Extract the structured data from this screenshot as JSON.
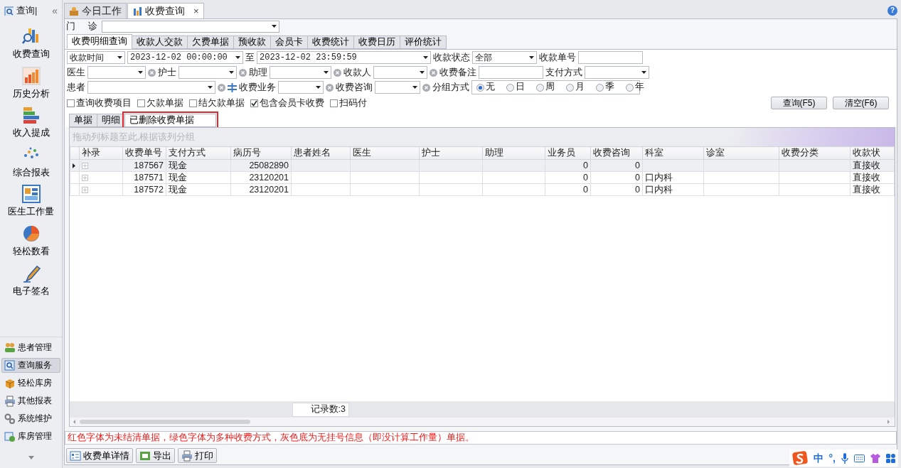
{
  "sidebar": {
    "title": "查询|",
    "collapse": "«",
    "items": [
      {
        "label": "收费查询"
      },
      {
        "label": "历史分析"
      },
      {
        "label": "收入提成"
      },
      {
        "label": "综合报表"
      },
      {
        "label": "医生工作量"
      },
      {
        "label": "轻松数看"
      },
      {
        "label": "电子签名"
      }
    ],
    "groups": [
      {
        "label": "患者管理",
        "selected": false
      },
      {
        "label": "查询服务",
        "selected": true
      },
      {
        "label": "轻松库房",
        "selected": false
      },
      {
        "label": "其他报表",
        "selected": false
      },
      {
        "label": "系统维护",
        "selected": false
      },
      {
        "label": "库房管理",
        "selected": false
      }
    ]
  },
  "tabs": [
    {
      "label": "今日工作",
      "selected": false
    },
    {
      "label": "收费查询",
      "selected": true,
      "close": "×"
    }
  ],
  "help": "?",
  "clinic": {
    "labels": [
      "门",
      "诊"
    ]
  },
  "query_tabs": [
    {
      "label": "收费明细查询",
      "selected": true
    },
    {
      "label": "收款人交款",
      "selected": false
    },
    {
      "label": "欠费单据",
      "selected": false
    },
    {
      "label": "预收款",
      "selected": false
    },
    {
      "label": "会员卡",
      "selected": false
    },
    {
      "label": "收费统计",
      "selected": false
    },
    {
      "label": "收费日历",
      "selected": false
    },
    {
      "label": "评价统计",
      "selected": false
    }
  ],
  "filter_rows": [
    [
      {
        "kind": "select",
        "value": "收款时间"
      },
      {
        "kind": "select",
        "value": "2023-12-02 00:00:00"
      },
      {
        "kind": "label",
        "text": "至"
      },
      {
        "kind": "select",
        "value": "2023-12-02 23:59:59"
      },
      {
        "kind": "label",
        "text": "收款状态"
      },
      {
        "kind": "select",
        "value": "全部"
      },
      {
        "kind": "label",
        "text": "收款单号"
      },
      {
        "kind": "text"
      }
    ],
    [
      {
        "kind": "label",
        "text": "医生"
      },
      {
        "kind": "combo"
      },
      {
        "kind": "label",
        "text": "护士"
      },
      {
        "kind": "combo"
      },
      {
        "kind": "label",
        "text": "助理"
      },
      {
        "kind": "combo"
      },
      {
        "kind": "label",
        "text": "收款人"
      },
      {
        "kind": "combo"
      },
      {
        "kind": "label",
        "text": "收费备注"
      },
      {
        "kind": "text"
      },
      {
        "kind": "label",
        "text": "支付方式"
      },
      {
        "kind": "select"
      }
    ],
    [
      {
        "kind": "label",
        "text": "患者"
      },
      {
        "kind": "combo",
        "add": true
      },
      {
        "kind": "label",
        "text": "收费业务"
      },
      {
        "kind": "combo"
      },
      {
        "kind": "label",
        "text": "收费咨询"
      },
      {
        "kind": "combo"
      },
      {
        "kind": "label",
        "text": "分组方式"
      },
      {
        "kind": "radio",
        "options": [
          {
            "label": "无",
            "selected": true
          },
          {
            "label": "日",
            "selected": false
          },
          {
            "label": "周",
            "selected": false
          },
          {
            "label": "月",
            "selected": false
          },
          {
            "label": "季",
            "selected": false
          },
          {
            "label": "年",
            "selected": false
          }
        ]
      }
    ]
  ],
  "checkboxes": [
    {
      "label": "查询收费项目",
      "checked": false
    },
    {
      "label": "欠款单据",
      "checked": false
    },
    {
      "label": "结欠款单据",
      "checked": false
    },
    {
      "label": "包含会员卡收费",
      "checked": true
    },
    {
      "label": "扫码付",
      "checked": false
    }
  ],
  "buttons": [
    "查询(F5)",
    "清空(F6)"
  ],
  "sub_tabs": [
    {
      "label": "单据",
      "selected": false,
      "highlighted": false
    },
    {
      "label": "明细",
      "selected": false,
      "highlighted": false
    },
    {
      "label": "已删除收费单据",
      "selected": true,
      "highlighted": true
    }
  ],
  "grid": {
    "group_hint": "拖动列标题至此,根据该列分组",
    "columns": [
      "补录",
      "收费单号",
      "支付方式",
      "病历号",
      "患者姓名",
      "医生",
      "护士",
      "助理",
      "业务员",
      "收费咨询",
      "科室",
      "诊室",
      "收费分类",
      "收款状"
    ],
    "rows": [
      {
        "selected": true,
        "cells": [
          null,
          "187567",
          "现金",
          "25082890",
          null,
          null,
          null,
          null,
          "0",
          "0",
          null,
          null,
          null,
          "直接收"
        ]
      },
      {
        "selected": false,
        "cells": [
          null,
          "187571",
          "现金",
          "23120201",
          null,
          null,
          null,
          null,
          "0",
          "0",
          "口内科",
          null,
          null,
          "直接收"
        ]
      },
      {
        "selected": false,
        "cells": [
          null,
          "187572",
          "现金",
          "23120201",
          null,
          null,
          null,
          null,
          "0",
          "0",
          "口内科",
          null,
          null,
          "直接收"
        ]
      }
    ],
    "record_count": "记录数:3"
  },
  "message": "红色字体为未结清单据，绿色字体为多种收费方式，灰色底为无挂号信息（即没计算工作量）单据。",
  "bottom_buttons": [
    "收费单详情",
    "导出",
    "打印"
  ],
  "ime": {
    "mode": "中",
    "punct": "°,"
  }
}
